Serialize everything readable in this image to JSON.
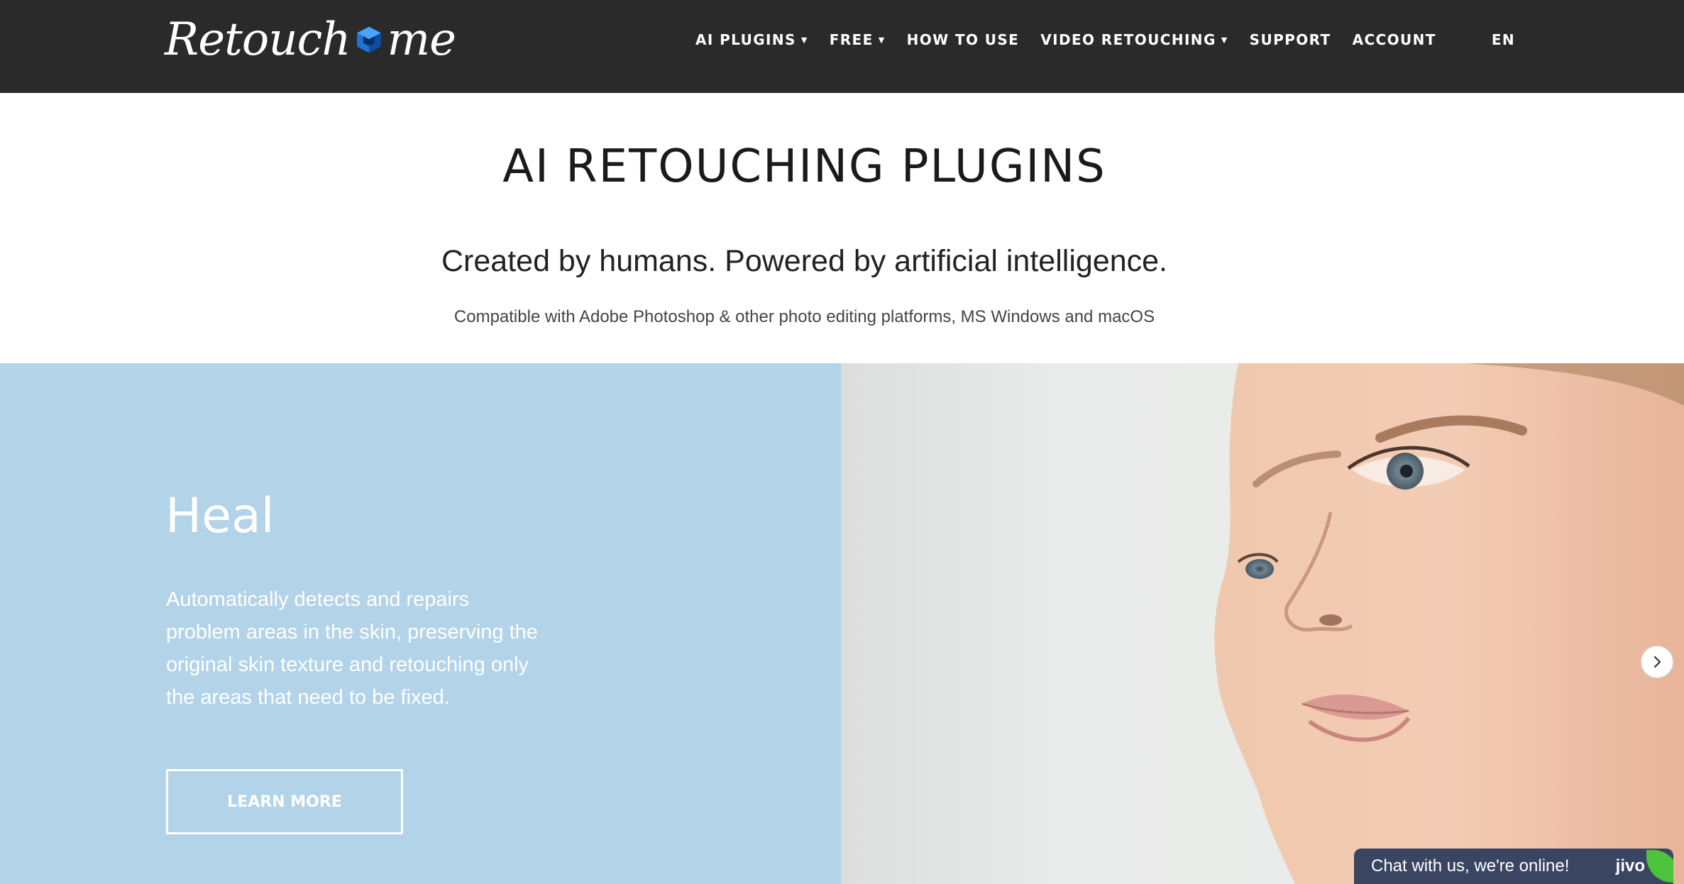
{
  "header": {
    "logo": {
      "left": "Retouch",
      "right": "me"
    },
    "nav": [
      {
        "label": "AI PLUGINS",
        "dropdown": true
      },
      {
        "label": "FREE",
        "dropdown": true
      },
      {
        "label": "HOW TO USE",
        "dropdown": false
      },
      {
        "label": "VIDEO RETOUCHING",
        "dropdown": true
      },
      {
        "label": "SUPPORT",
        "dropdown": false
      },
      {
        "label": "ACCOUNT",
        "dropdown": false
      }
    ],
    "language": "EN"
  },
  "hero": {
    "title": "AI RETOUCHING PLUGINS",
    "subtitle": "Created by humans. Powered by artificial intelligence.",
    "compat": "Compatible with Adobe Photoshop & other photo editing platforms, MS Windows and macOS"
  },
  "slide": {
    "title": "Heal",
    "description": "Automatically detects and repairs problem areas in the skin, preserving the original skin texture and retouching only the areas that need to be fixed.",
    "button_label": "LEARN MORE",
    "next_icon": "chevron-right-icon"
  },
  "chat": {
    "text": "Chat with us, we're online!",
    "brand": "jivo"
  },
  "colors": {
    "topbar": "#2a2a2a",
    "slide_left": "#b2d3e8",
    "chat_bg": "#3a4661",
    "chat_accent": "#4bc33a",
    "logo_cube": "#1e73d6"
  }
}
